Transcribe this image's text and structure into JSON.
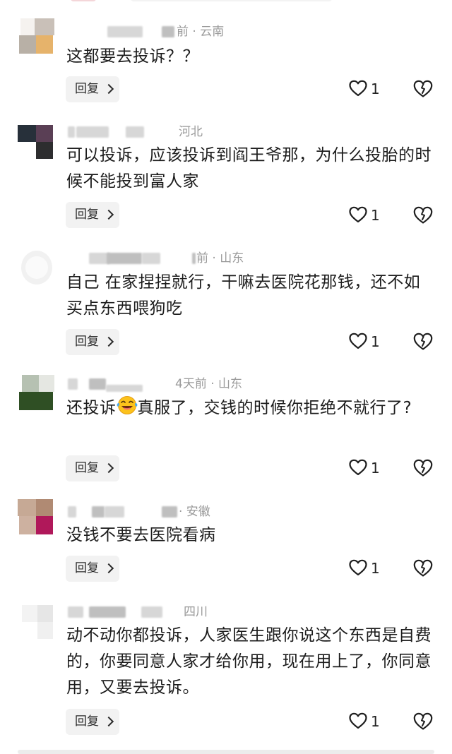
{
  "comments": [
    {
      "time_location": "前 · 云南",
      "text": "这都要去投诉？？",
      "reply_label": "回复",
      "likes": "1"
    },
    {
      "time_location": "河北",
      "text": "可以投诉，应该投诉到阎王爷那，为什么投胎的时候不能投到富人家",
      "reply_label": "回复",
      "likes": "1"
    },
    {
      "time_location": "前 · 山东",
      "text": "自己 在家捏捏就行，干嘛去医院花那钱，还不如买点东西喂狗吃",
      "reply_label": "回复",
      "likes": "1"
    },
    {
      "time_location": "4天前 · 山东",
      "text_before_emoji": "还投诉",
      "text_after_emoji": "真服了，交钱的时候你拒绝不就行了?",
      "emoji": "laughing-crying-emoji",
      "reply_label": "回复",
      "likes": "1"
    },
    {
      "time_location": "· 安徽",
      "text": "没钱不要去医院看病",
      "reply_label": "回复",
      "likes": "1"
    },
    {
      "time_location": "四川",
      "text": "动不动你都投诉，人家医生跟你说这个东西是自费的，你要同意人家才给你用，现在用上了，你同意用，又要去投诉。",
      "reply_label": "回复",
      "likes": "1"
    }
  ],
  "icons": {
    "like": "heart-outline-icon",
    "dislike": "broken-heart-icon",
    "reply_chevron": "chevron-right-icon"
  },
  "colors": {
    "meta_text": "#9a9a9a",
    "reply_bg": "#f2f2f2",
    "body_text": "#1c1c1c"
  }
}
